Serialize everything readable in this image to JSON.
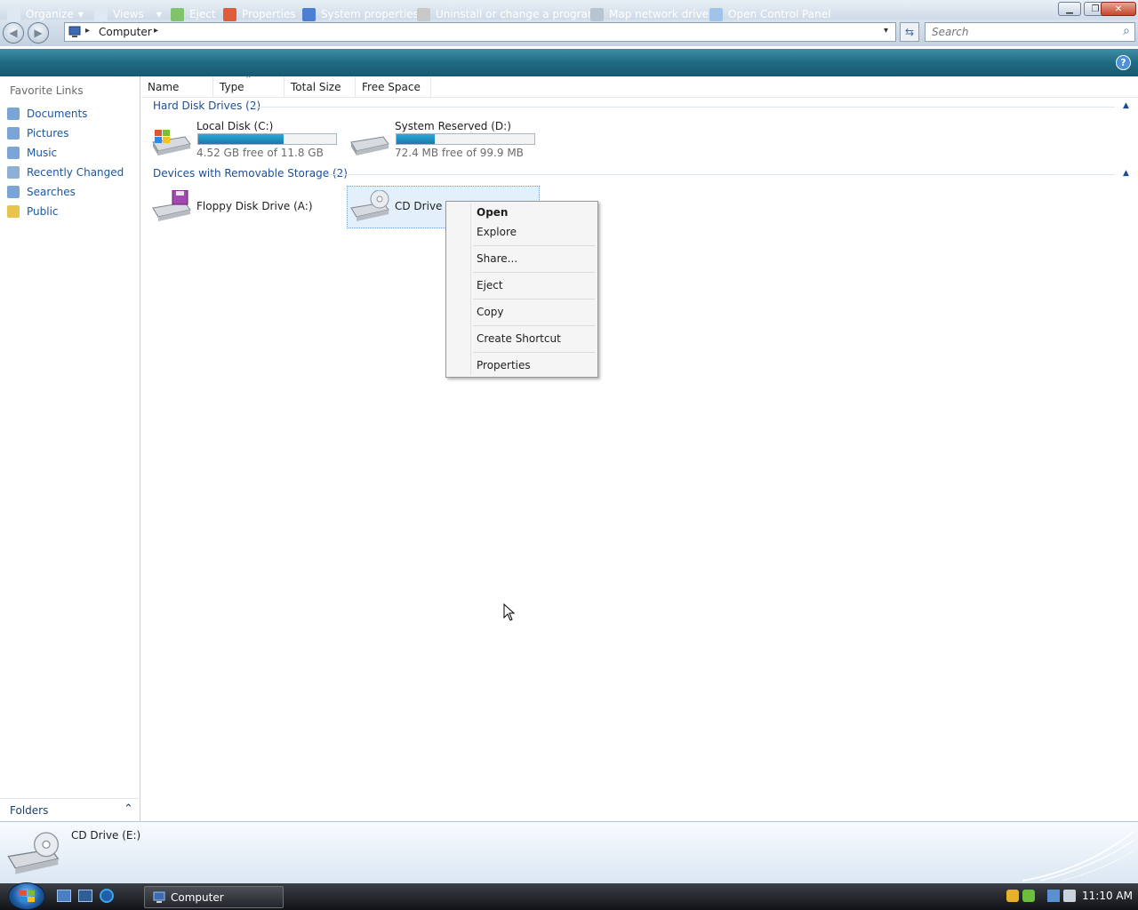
{
  "window": {
    "minimize_glyph": "▁",
    "maximize_glyph": "❐",
    "close_glyph": "✕"
  },
  "address": {
    "back_glyph": "◀",
    "forward_glyph": "▶",
    "crumb_root_arrow": "▸",
    "location": "Computer",
    "crumb_trailing_arrow": "▸",
    "dropdown_glyph": "▾",
    "refresh_glyph": "⇆"
  },
  "search": {
    "placeholder": "Search",
    "icon_glyph": "⌕"
  },
  "toolbar": {
    "organize": "Organize",
    "views": "Views",
    "eject": "Eject",
    "properties": "Properties",
    "system_properties": "System properties",
    "uninstall": "Uninstall or change a program",
    "map_network": "Map network drive",
    "control_panel": "Open Control Panel",
    "help_glyph": "?"
  },
  "sidebar": {
    "title": "Favorite Links",
    "items": [
      {
        "label": "Documents"
      },
      {
        "label": "Pictures"
      },
      {
        "label": "Music"
      },
      {
        "label": "Recently Changed"
      },
      {
        "label": "Searches"
      },
      {
        "label": "Public"
      }
    ],
    "folders_label": "Folders",
    "folders_chevron": "⌃"
  },
  "columns": [
    "Name",
    "Type",
    "Total Size",
    "Free Space"
  ],
  "groups": {
    "hard_disks": {
      "title": "Hard Disk Drives (2)",
      "drives": [
        {
          "name": "Local Disk (C:)",
          "free": "4.52 GB free of 11.8 GB",
          "used_fraction": 0.62
        },
        {
          "name": "System Reserved (D:)",
          "free": "72.4 MB free of 99.9 MB",
          "used_fraction": 0.28
        }
      ]
    },
    "removable": {
      "title": "Devices with Removable Storage (2)",
      "drives": [
        {
          "name": "Floppy Disk Drive (A:)"
        },
        {
          "name": "CD Drive (E:)"
        }
      ]
    }
  },
  "context_menu": {
    "items": [
      "Open",
      "Explore",
      "Share...",
      "Eject",
      "Copy",
      "Create Shortcut",
      "Properties"
    ]
  },
  "details": {
    "name": "CD Drive (E:)"
  },
  "taskbar": {
    "active_window": "Computer",
    "clock": "11:10 AM"
  },
  "colors": {
    "command_bar": "#1f6a83",
    "link": "#1a57a8",
    "group_header": "#1d4e91",
    "progress": "#1a79a9"
  }
}
